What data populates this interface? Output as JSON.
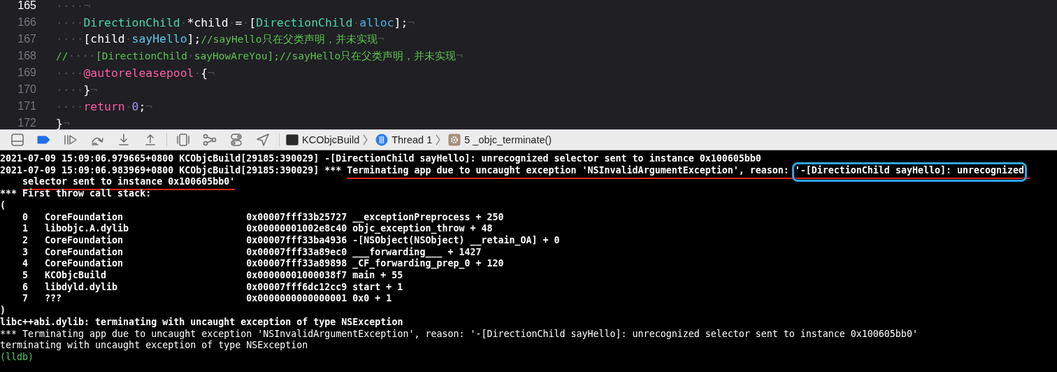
{
  "editor": {
    "lines": [
      {
        "number": "165",
        "current": true,
        "tokens": [
          {
            "kind": "invisible",
            "text": "····¬"
          }
        ]
      },
      {
        "number": "166",
        "current": false,
        "tokens": [
          {
            "kind": "invisible",
            "text": "····"
          },
          {
            "kind": "type",
            "text": "DirectionChild"
          },
          {
            "kind": "invisible",
            "text": "·"
          },
          {
            "kind": "plain",
            "text": "*child"
          },
          {
            "kind": "invisible",
            "text": "·"
          },
          {
            "kind": "plain",
            "text": "="
          },
          {
            "kind": "invisible",
            "text": "·"
          },
          {
            "kind": "plain",
            "text": "["
          },
          {
            "kind": "type",
            "text": "DirectionChild"
          },
          {
            "kind": "invisible",
            "text": "·"
          },
          {
            "kind": "method",
            "text": "alloc"
          },
          {
            "kind": "plain",
            "text": "];"
          },
          {
            "kind": "invisible",
            "text": "¬"
          }
        ]
      },
      {
        "number": "167",
        "current": false,
        "tokens": [
          {
            "kind": "invisible",
            "text": "····"
          },
          {
            "kind": "plain",
            "text": "[child"
          },
          {
            "kind": "invisible",
            "text": "·"
          },
          {
            "kind": "call",
            "text": "sayHello"
          },
          {
            "kind": "plain",
            "text": "];"
          },
          {
            "kind": "comment",
            "text": "//sayHello只在父类声明，并未实现"
          },
          {
            "kind": "invisible",
            "text": "¬"
          }
        ]
      },
      {
        "number": "168",
        "current": false,
        "tokens": [
          {
            "kind": "comment",
            "text": "//"
          },
          {
            "kind": "invisible",
            "text": "····"
          },
          {
            "kind": "comment",
            "text": "[DirectionChild"
          },
          {
            "kind": "invisible",
            "text": "·"
          },
          {
            "kind": "comment",
            "text": "sayHowAreYou];//sayHello只在父类声明，并未实现"
          },
          {
            "kind": "invisible",
            "text": "¬"
          }
        ]
      },
      {
        "number": "169",
        "current": false,
        "tokens": [
          {
            "kind": "invisible",
            "text": "····"
          },
          {
            "kind": "keyword",
            "text": "@autoreleasepool"
          },
          {
            "kind": "invisible",
            "text": "·"
          },
          {
            "kind": "plain",
            "text": "{"
          },
          {
            "kind": "invisible",
            "text": "¬"
          }
        ]
      },
      {
        "number": "170",
        "current": false,
        "tokens": [
          {
            "kind": "invisible",
            "text": "····"
          },
          {
            "kind": "plain",
            "text": "}"
          },
          {
            "kind": "invisible",
            "text": "¬"
          }
        ]
      },
      {
        "number": "171",
        "current": false,
        "tokens": [
          {
            "kind": "invisible",
            "text": "····"
          },
          {
            "kind": "keyword",
            "text": "return"
          },
          {
            "kind": "invisible",
            "text": "·"
          },
          {
            "kind": "number",
            "text": "0"
          },
          {
            "kind": "plain",
            "text": ";"
          },
          {
            "kind": "invisible",
            "text": "¬"
          }
        ]
      },
      {
        "number": "172",
        "current": false,
        "tokens": [
          {
            "kind": "plain",
            "text": "}"
          },
          {
            "kind": "invisible",
            "text": "¬"
          }
        ]
      }
    ]
  },
  "debug_bar": {
    "breakpoints_active": true,
    "breadcrumb": [
      {
        "kind": "target",
        "label": "KCObjcBuild"
      },
      {
        "kind": "thread",
        "label": "Thread 1"
      },
      {
        "kind": "frame",
        "label": "5 _objc_terminate()"
      }
    ]
  },
  "console": {
    "lines": [
      {
        "kind": "log",
        "text": "2021-07-09 15:09:06.979665+0800 KCObjcBuild[29185:390029] -[DirectionChild sayHello]: unrecognized selector sent to instance 0x100605bb0"
      },
      {
        "kind": "log",
        "segments": [
          {
            "text": "2021-07-09 15:09:06.983969+0800 KCObjcBuild[29185:390029] *** "
          },
          {
            "text": "Terminating app due to uncaught exception 'NSInvalidArgumentException', reason: ",
            "underlined": true
          },
          {
            "text": "'-[DirectionChild sayHello]: unrecognized",
            "boxed": true,
            "underlined": true
          },
          {
            "text": " selector sent to instance 0x100605bb0'",
            "underlined": true
          }
        ]
      },
      {
        "kind": "log",
        "text": "*** First throw call stack:"
      },
      {
        "kind": "log",
        "text": "("
      },
      {
        "kind": "frame",
        "index": "0",
        "library": "CoreFoundation",
        "address": "0x00007fff33b25727",
        "symbol": "__exceptionPreprocess + 250"
      },
      {
        "kind": "frame",
        "index": "1",
        "library": "libobjc.A.dylib",
        "address": "0x00000001002e8c40",
        "symbol": "objc_exception_throw + 48"
      },
      {
        "kind": "frame",
        "index": "2",
        "library": "CoreFoundation",
        "address": "0x00007fff33ba4936",
        "symbol": "-[NSObject(NSObject) __retain_OA] + 0"
      },
      {
        "kind": "frame",
        "index": "3",
        "library": "CoreFoundation",
        "address": "0x00007fff33a89ec0",
        "symbol": "___forwarding___ + 1427"
      },
      {
        "kind": "frame",
        "index": "4",
        "library": "CoreFoundation",
        "address": "0x00007fff33a89898",
        "symbol": "_CF_forwarding_prep_0 + 120"
      },
      {
        "kind": "frame",
        "index": "5",
        "library": "KCObjcBuild",
        "address": "0x00000001000038f7",
        "symbol": "main + 55"
      },
      {
        "kind": "frame",
        "index": "6",
        "library": "libdyld.dylib",
        "address": "0x00007fff6dc12cc9",
        "symbol": "start + 1"
      },
      {
        "kind": "frame",
        "index": "7",
        "library": "???",
        "address": "0x0000000000000001",
        "symbol": "0x0 + 1"
      },
      {
        "kind": "log",
        "text": ")"
      },
      {
        "kind": "log",
        "text": "libc++abi.dylib: terminating with uncaught exception of type NSException"
      },
      {
        "kind": "plain",
        "text": "*** Terminating app due to uncaught exception 'NSInvalidArgumentException', reason: '-[DirectionChild sayHello]: unrecognized selector sent to instance 0x100605bb0'"
      },
      {
        "kind": "plain",
        "text": "terminating with uncaught exception of type NSException"
      },
      {
        "kind": "prompt",
        "text": "(lldb)"
      }
    ]
  }
}
